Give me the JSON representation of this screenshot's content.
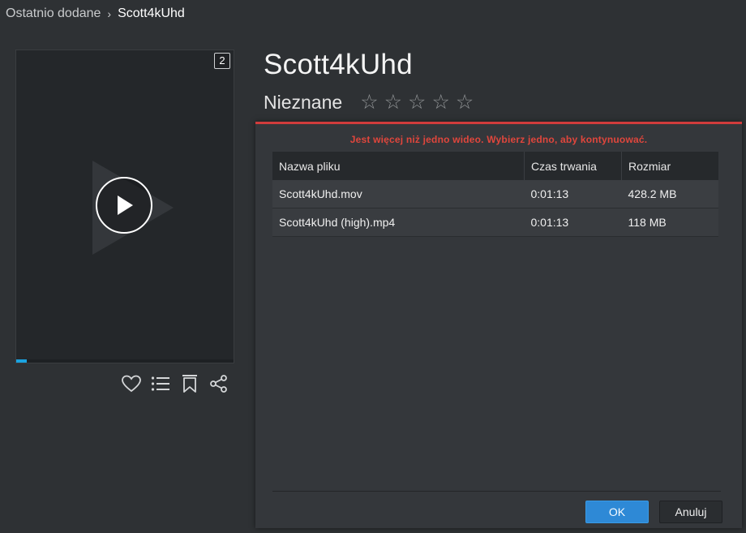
{
  "breadcrumb": {
    "parent": "Ostatnio dodane",
    "separator": "›",
    "current": "Scott4kUhd"
  },
  "poster": {
    "badge_count": "2",
    "progress_fraction": 0.05,
    "accent_color": "#1aa3e0"
  },
  "actions": {
    "icons": [
      "heart-icon",
      "list-icon",
      "bookmark-icon",
      "share-icon"
    ]
  },
  "header": {
    "title": "Scott4kUhd",
    "rating_label": "Nieznane",
    "stars": [
      "☆",
      "☆",
      "☆",
      "☆",
      "☆"
    ],
    "rating_value": 0
  },
  "dialog": {
    "message": "Jest więcej niż jedno wideo. Wybierz jedno, aby kontynuować.",
    "accent_color": "#d13c3c",
    "columns": [
      "Nazwa pliku",
      "Czas trwania",
      "Rozmiar"
    ],
    "rows": [
      [
        "Scott4kUhd.mov",
        "0:01:13",
        "428.2 MB"
      ],
      [
        "Scott4kUhd (high).mp4",
        "0:01:13",
        "118 MB"
      ]
    ],
    "ok_label": "OK",
    "cancel_label": "Anuluj"
  }
}
